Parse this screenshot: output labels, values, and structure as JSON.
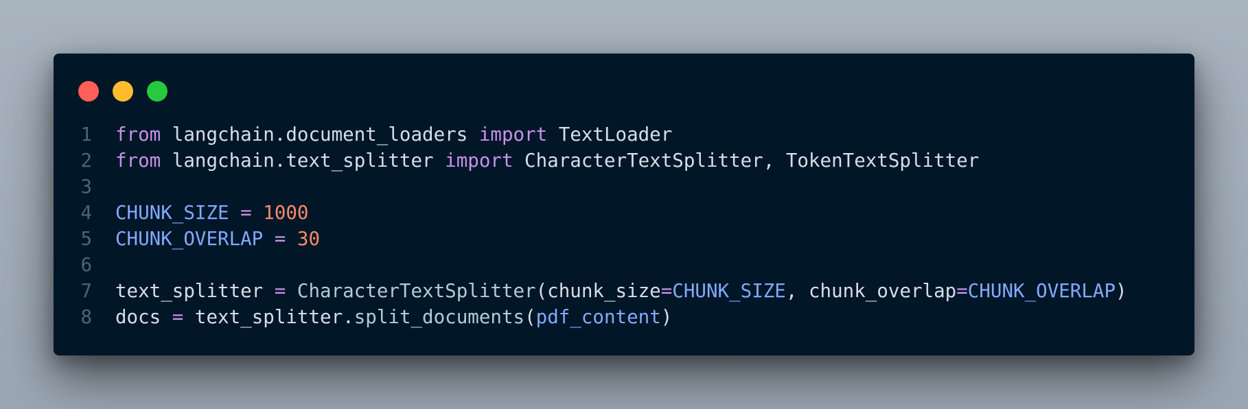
{
  "window": {
    "dots": [
      {
        "name": "close-dot",
        "color": "#ff5f56"
      },
      {
        "name": "minimize-dot",
        "color": "#ffbd2e"
      },
      {
        "name": "maximize-dot",
        "color": "#27c93f"
      }
    ]
  },
  "code": {
    "line_numbers": [
      "1",
      "2",
      "3",
      "4",
      "5",
      "6",
      "7",
      "8"
    ],
    "l1": {
      "kw1": "from",
      "mod": " langchain.document_loaders ",
      "kw2": "import",
      "name": " TextLoader"
    },
    "l2": {
      "kw1": "from",
      "mod": " langchain.text_splitter ",
      "kw2": "import",
      "name": " CharacterTextSplitter, TokenTextSplitter"
    },
    "l4": {
      "const": "CHUNK_SIZE",
      "sp1": " ",
      "eq": "=",
      "sp2": " ",
      "num": "1000"
    },
    "l5": {
      "const": "CHUNK_OVERLAP",
      "sp1": " ",
      "eq": "=",
      "sp2": " ",
      "num": "30"
    },
    "l7": {
      "var": "text_splitter",
      "sp1": " ",
      "eq": "=",
      "sp2": " ",
      "cls": "CharacterTextSplitter",
      "open": "(chunk_size",
      "eq2": "=",
      "arg1": "CHUNK_SIZE",
      "mid": ", chunk_overlap",
      "eq3": "=",
      "arg2": "CHUNK_OVERLAP",
      "close": ")"
    },
    "l8": {
      "var": "docs",
      "sp1": " ",
      "eq": "=",
      "sp2": " ",
      "obj": "text_splitter.",
      "method": "split_documents",
      "open": "(",
      "arg": "pdf_content",
      "close": ")"
    }
  }
}
